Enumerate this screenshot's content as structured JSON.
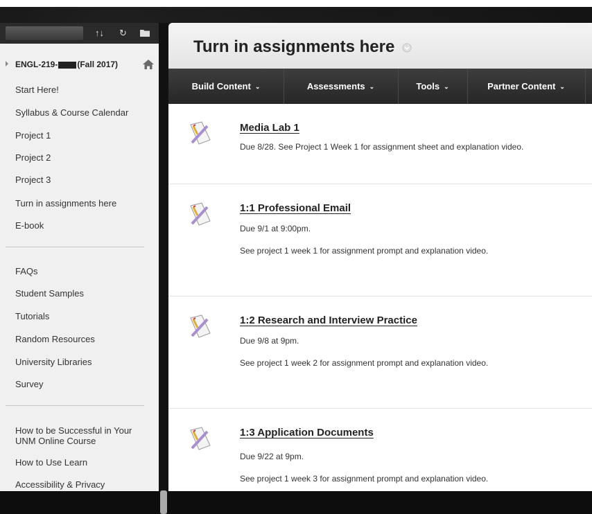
{
  "course": {
    "title_prefix": "ENGL-219-",
    "title_suffix": "(Fall 2017)"
  },
  "toolbar": {
    "icons": [
      "sort-icon",
      "refresh-icon",
      "folder-icon"
    ],
    "sort_glyph": "↑↓",
    "refresh_glyph": "↻"
  },
  "sidebar": {
    "group1": [
      "Start Here!",
      "Syllabus & Course Calendar",
      "Project 1",
      "Project 2",
      "Project 3",
      "Turn in assignments here",
      "E-book"
    ],
    "group2": [
      "FAQs",
      "Student Samples",
      "Tutorials",
      "Random Resources",
      "University Libraries",
      "Survey"
    ],
    "group3": [
      "How to be Successful in Your UNM Online Course",
      "How to Use Learn",
      "Accessibility & Privacy"
    ]
  },
  "page": {
    "title": "Turn in assignments here"
  },
  "action_bar": {
    "buttons": [
      {
        "label": "Build Content"
      },
      {
        "label": "Assessments"
      },
      {
        "label": "Tools"
      },
      {
        "label": "Partner Content"
      }
    ],
    "caret": "⌄"
  },
  "items": [
    {
      "title": "Media Lab 1",
      "lines": [
        "Due 8/28. See Project 1 Week 1 for assignment sheet and explanation video."
      ]
    },
    {
      "title": "1:1 Professional Email",
      "lines": [
        "Due 9/1 at 9:00pm.",
        "See project 1 week 1 for assignment prompt and explanation video."
      ]
    },
    {
      "title": "1:2 Research and Interview Practice",
      "lines": [
        "Due 9/8 at 9pm.",
        "See project 1 week 2 for assignment prompt and explanation video."
      ]
    },
    {
      "title": "1:3 Application Documents",
      "lines": [
        "Due 9/22 at 9pm.",
        "See project 1 week 3 for assignment prompt and explanation video."
      ]
    }
  ],
  "colors": {
    "action_bar": "#2e2e2e",
    "sidebar_bg": "#f0f0f0",
    "text": "#222222"
  }
}
